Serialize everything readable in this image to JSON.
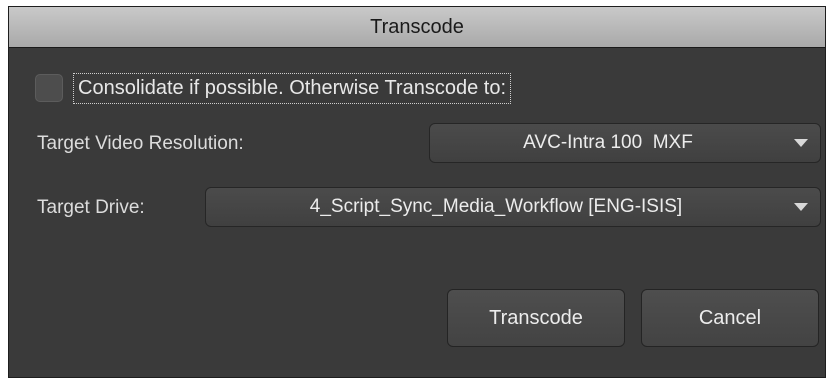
{
  "dialog": {
    "title": "Transcode",
    "consolidate": {
      "label": "Consolidate if possible. Otherwise Transcode to:",
      "checked": false
    },
    "resolution": {
      "label": "Target Video Resolution:",
      "value": "AVC-Intra 100  MXF"
    },
    "drive": {
      "label": "Target Drive:",
      "value": "4_Script_Sync_Media_Workflow [ENG-ISIS]"
    },
    "buttons": {
      "transcode": "Transcode",
      "cancel": "Cancel"
    }
  },
  "icons": {
    "dropdown": "chevron-down-icon"
  }
}
